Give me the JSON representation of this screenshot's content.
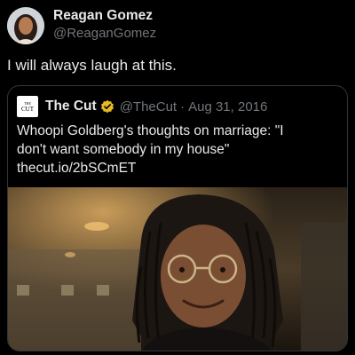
{
  "tweet": {
    "display_name": "Reagan Gomez",
    "handle": "@ReaganGomez",
    "text": "I will always laugh at this."
  },
  "quote": {
    "display_name": "The Cut",
    "handle": "@TheCut",
    "separator": "·",
    "date": "Aug 31, 2016",
    "logo_text_small": "THE",
    "logo_text": "CUT",
    "text_lines": [
      "Whoopi Goldberg's thoughts on marriage: \"I",
      "don't want somebody in my house\"",
      "thecut.io/2bSCmET"
    ],
    "verified_color": "#e8b923"
  },
  "icons": {
    "avatar": "profile-photo",
    "verified": "verified-badge-icon"
  }
}
